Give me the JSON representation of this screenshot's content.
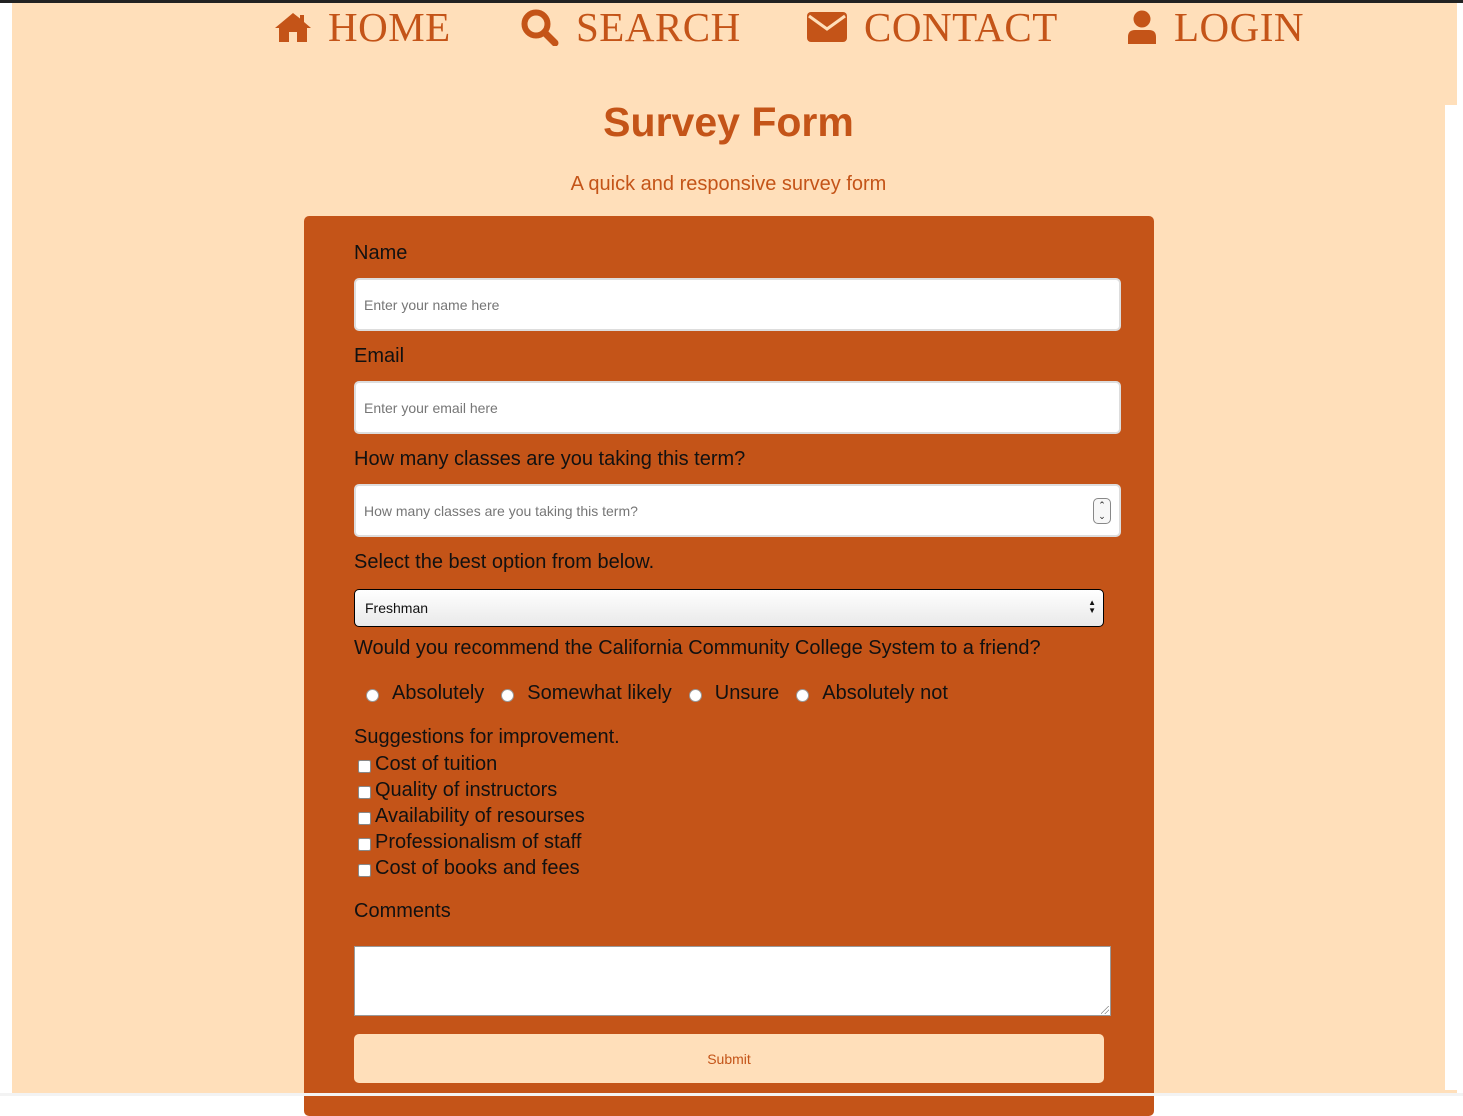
{
  "nav": {
    "items": [
      {
        "label": "HOME",
        "icon": "home-icon"
      },
      {
        "label": "SEARCH",
        "icon": "search-icon"
      },
      {
        "label": "CONTACT",
        "icon": "envelope-icon"
      },
      {
        "label": "LOGIN",
        "icon": "user-icon"
      }
    ]
  },
  "header": {
    "title": "Survey Form",
    "subtitle": "A quick and responsive survey form"
  },
  "form": {
    "name": {
      "label": "Name",
      "placeholder": "Enter your name here"
    },
    "email": {
      "label": "Email",
      "placeholder": "Enter your email here"
    },
    "classes": {
      "label": "How many classes are you taking this term?",
      "placeholder": "How many classes are you taking this term?"
    },
    "select": {
      "label": "Select the best option from below.",
      "value": "Freshman"
    },
    "recommend": {
      "label": "Would you recommend the California Community College System to a friend?",
      "options": [
        "Absolutely",
        "Somewhat likely",
        "Unsure",
        "Absolutely not"
      ]
    },
    "suggestions": {
      "label": "Suggestions for improvement.",
      "options": [
        "Cost of tuition",
        "Quality of instructors",
        "Availability of resourses",
        "Professionalism of staff",
        "Cost of books and fees"
      ]
    },
    "comments": {
      "label": "Comments"
    },
    "submit_label": "Submit"
  },
  "colors": {
    "accent": "#c45418",
    "background": "#ffdfba"
  }
}
